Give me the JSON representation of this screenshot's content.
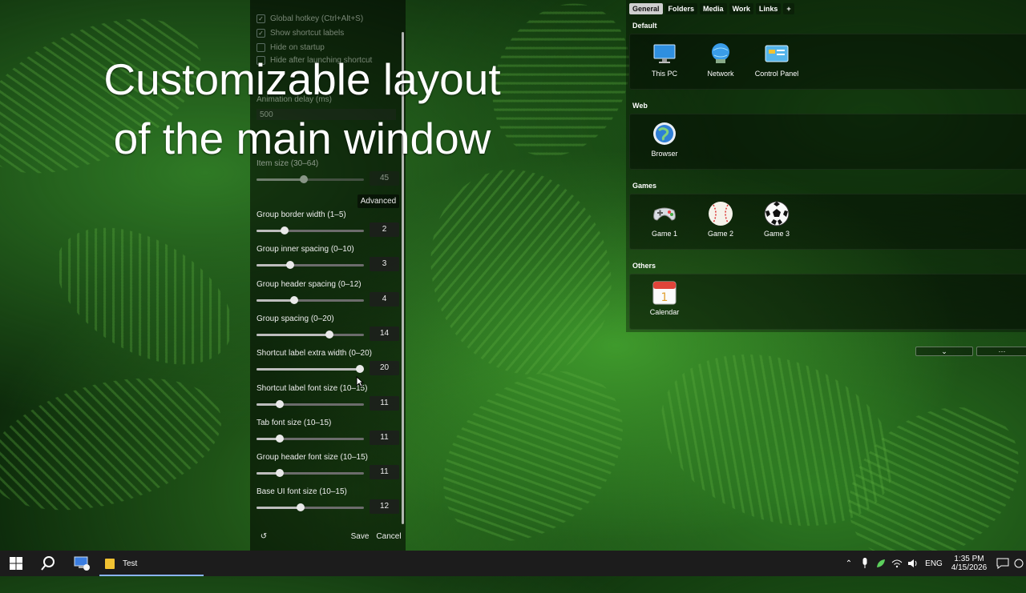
{
  "overlay_title": {
    "line1": "Customizable layout",
    "line2": "of the main window"
  },
  "settings": {
    "faded_options": [
      {
        "label": "Global hotkey (Ctrl+Alt+S)",
        "checked": true
      },
      {
        "label": "Show shortcut labels",
        "checked": true
      },
      {
        "label": "Hide on startup",
        "checked": false
      },
      {
        "label": "Hide after launching shortcut",
        "checked": false
      }
    ],
    "animation_delay": {
      "label": "Animation delay (ms)",
      "value": "500"
    },
    "item_size": {
      "label": "Item size (30–64)",
      "value": "45",
      "fraction": 0.44
    },
    "advanced_label": "Advanced",
    "sliders": [
      {
        "label": "Group border width (1–5)",
        "value": "2",
        "fraction": 0.26
      },
      {
        "label": "Group inner spacing (0–10)",
        "value": "3",
        "fraction": 0.31
      },
      {
        "label": "Group header spacing (0–12)",
        "value": "4",
        "fraction": 0.35
      },
      {
        "label": "Group spacing (0–20)",
        "value": "14",
        "fraction": 0.68
      },
      {
        "label": "Shortcut label extra width (0–20)",
        "value": "20",
        "fraction": 0.96
      },
      {
        "label": "Shortcut label font size (10–15)",
        "value": "11",
        "fraction": 0.22
      },
      {
        "label": "Tab font size (10–15)",
        "value": "11",
        "fraction": 0.22
      },
      {
        "label": "Group header font size (10–15)",
        "value": "11",
        "fraction": 0.22
      },
      {
        "label": "Base UI font size (10–15)",
        "value": "12",
        "fraction": 0.41
      }
    ],
    "reset_icon": "↺",
    "save_label": "Save",
    "cancel_label": "Cancel"
  },
  "launcher": {
    "tabs": [
      "General",
      "Folders",
      "Media",
      "Work",
      "Links",
      "+"
    ],
    "active_tab": "General",
    "groups": [
      {
        "name": "Default",
        "items": [
          {
            "label": "This PC",
            "icon": "monitor-icon"
          },
          {
            "label": "Network",
            "icon": "network-globe-icon"
          },
          {
            "label": "Control Panel",
            "icon": "control-panel-icon"
          }
        ]
      },
      {
        "name": "Web",
        "items": [
          {
            "label": "Browser",
            "icon": "browser-globe-icon"
          }
        ]
      },
      {
        "name": "Games",
        "items": [
          {
            "label": "Game 1",
            "icon": "gamepad-icon"
          },
          {
            "label": "Game 2",
            "icon": "baseball-icon"
          },
          {
            "label": "Game 3",
            "icon": "soccer-ball-icon"
          }
        ]
      },
      {
        "name": "Others",
        "items": [
          {
            "label": "Calendar",
            "icon": "calendar-icon"
          }
        ]
      }
    ],
    "collapse_symbol": "⌄",
    "more_symbol": "···"
  },
  "taskbar": {
    "app_label": "Test",
    "tray_lang": "ENG",
    "time": "1:35 PM",
    "date": "4/15/2026"
  }
}
